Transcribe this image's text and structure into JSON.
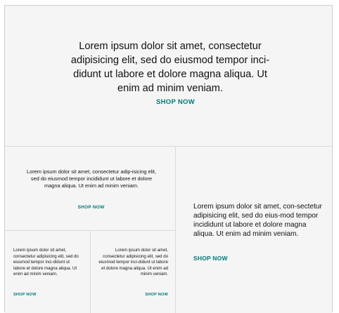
{
  "hero": {
    "text": "Lorem ipsum dolor sit amet, consectetur adipisicing elit, sed do eiusmod tempor inci-didunt ut labore et dolore magna aliqua. Ut enim ad minim veniam.",
    "cta": "SHOP NOW"
  },
  "left_top": {
    "text": "Lorem ipsum dolor sit amet, consectetur adip-isicing elit, sed do eiusmod tempor incididunt ut labore et dolore magna aliqua. Ut enim ad minim veniam.",
    "cta": "SHOP NOW"
  },
  "right_panel": {
    "text": "Lorem ipsum dolor sit amet, con-sectetur adipisicing elit, sed do eius-mod tempor incididunt ut labore et dolore magna aliqua. Ut enim ad minim veniam.",
    "cta": "SHOP NOW"
  },
  "bottom_left": {
    "text": "Lorem ipsum dolor sit amet, consectetur adipisicing elit, sed do eiusmod tempor inci-didunt ut labore et dolore magna aliqua. Ut enim ad minim veniam.",
    "cta": "SHOP NOW"
  },
  "bottom_middle": {
    "text": "Lorem ipsum dolor sit amet, consectetur adipisicing elit, sed do eiusmod tempor inci-didunt ut labore et dolore magna aliqua. Ut enim ad minim veniam.",
    "cta": "SHOP NOW"
  }
}
